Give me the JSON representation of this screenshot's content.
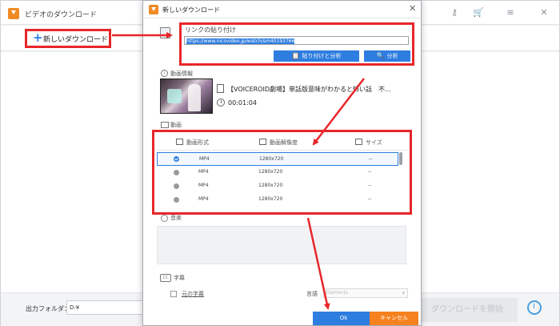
{
  "main_window": {
    "title": "ビデオのダウンロード",
    "toolbar": {
      "new_download_label": "新しいダウンロード",
      "plus": "+"
    },
    "icons": {
      "key": "⚷",
      "cart": "🛒",
      "menu": "≡",
      "close": "✕"
    },
    "bottom": {
      "output_folder_label": "出力フォルダ：",
      "output_folder_value": "D:¥",
      "start_download_label": "ダウンロードを開始"
    }
  },
  "dialog": {
    "title": "新しいダウンロード",
    "close": "✕",
    "paste_link": {
      "label": "リンクの貼り付け",
      "url": "https://www.nicovideo.jp/watch/sm40193766",
      "paste_analyze_button": "貼り付けと分析",
      "analyze_button": "分析"
    },
    "video_info": {
      "label": "動画情報",
      "title": "【VOICEROID劇場】単話版意味がわかると怖い話　不...",
      "duration": "00:01:04"
    },
    "video": {
      "label": "動画",
      "columns": {
        "format": "動画形式",
        "resolution": "動画解像度",
        "size": "サイズ"
      },
      "rows": [
        {
          "format": "MP4",
          "resolution": "1280x720",
          "size": "--",
          "selected": true
        },
        {
          "format": "MP4",
          "resolution": "1280x720",
          "size": "--",
          "selected": false
        },
        {
          "format": "MP4",
          "resolution": "1280x720",
          "size": "--",
          "selected": false
        },
        {
          "format": "MP4",
          "resolution": "1280x720",
          "size": "--",
          "selected": false
        }
      ]
    },
    "audio": {
      "label": "音楽"
    },
    "subtitles": {
      "label": "字幕",
      "cc": "CC",
      "original_subtitle_label": "元の字幕",
      "language_label": "言語",
      "language_placeholder": "Elements"
    },
    "ok_button": "Ok",
    "cancel_button": "キャンセル"
  },
  "colors": {
    "accent_blue": "#2e7de0",
    "annotation_red": "#e8262a",
    "cancel_orange": "#f5821f",
    "app_orange": "#f08a24"
  }
}
